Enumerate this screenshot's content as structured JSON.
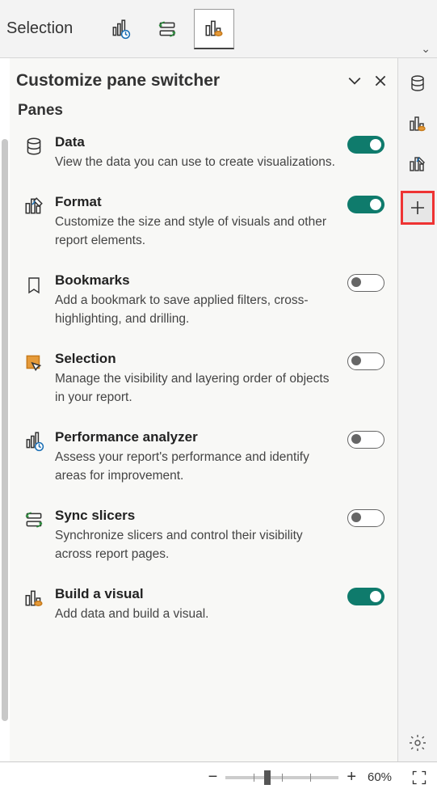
{
  "toolbar": {
    "tab_label": "Selection",
    "buttons": [
      "performance-analyzer",
      "sync-slicers",
      "build-visual"
    ]
  },
  "panel": {
    "title": "Customize pane switcher",
    "section": "Panes"
  },
  "panes": [
    {
      "id": "data",
      "name": "Data",
      "desc": "View the data you can use to create visualizations.",
      "on": true,
      "icon": "database"
    },
    {
      "id": "format",
      "name": "Format",
      "desc": "Customize the size and style of visuals and other report elements.",
      "on": true,
      "icon": "paintbrush"
    },
    {
      "id": "bookmarks",
      "name": "Bookmarks",
      "desc": "Add a bookmark to save applied filters, cross-highlighting, and drilling.",
      "on": false,
      "icon": "bookmark"
    },
    {
      "id": "selection",
      "name": "Selection",
      "desc": "Manage the visibility and layering order of objects in your report.",
      "on": false,
      "icon": "selection"
    },
    {
      "id": "perf",
      "name": "Performance analyzer",
      "desc": "Assess your report's performance and identify areas for improvement.",
      "on": false,
      "icon": "perf"
    },
    {
      "id": "sync",
      "name": "Sync slicers",
      "desc": "Synchronize slicers and control their visibility across report pages.",
      "on": false,
      "icon": "sync"
    },
    {
      "id": "build",
      "name": "Build a visual",
      "desc": "Add data and build a visual.",
      "on": true,
      "icon": "build"
    }
  ],
  "rail": {
    "items": [
      "database",
      "build",
      "paintbrush",
      "plus"
    ]
  },
  "zoom": {
    "value": "60%"
  }
}
